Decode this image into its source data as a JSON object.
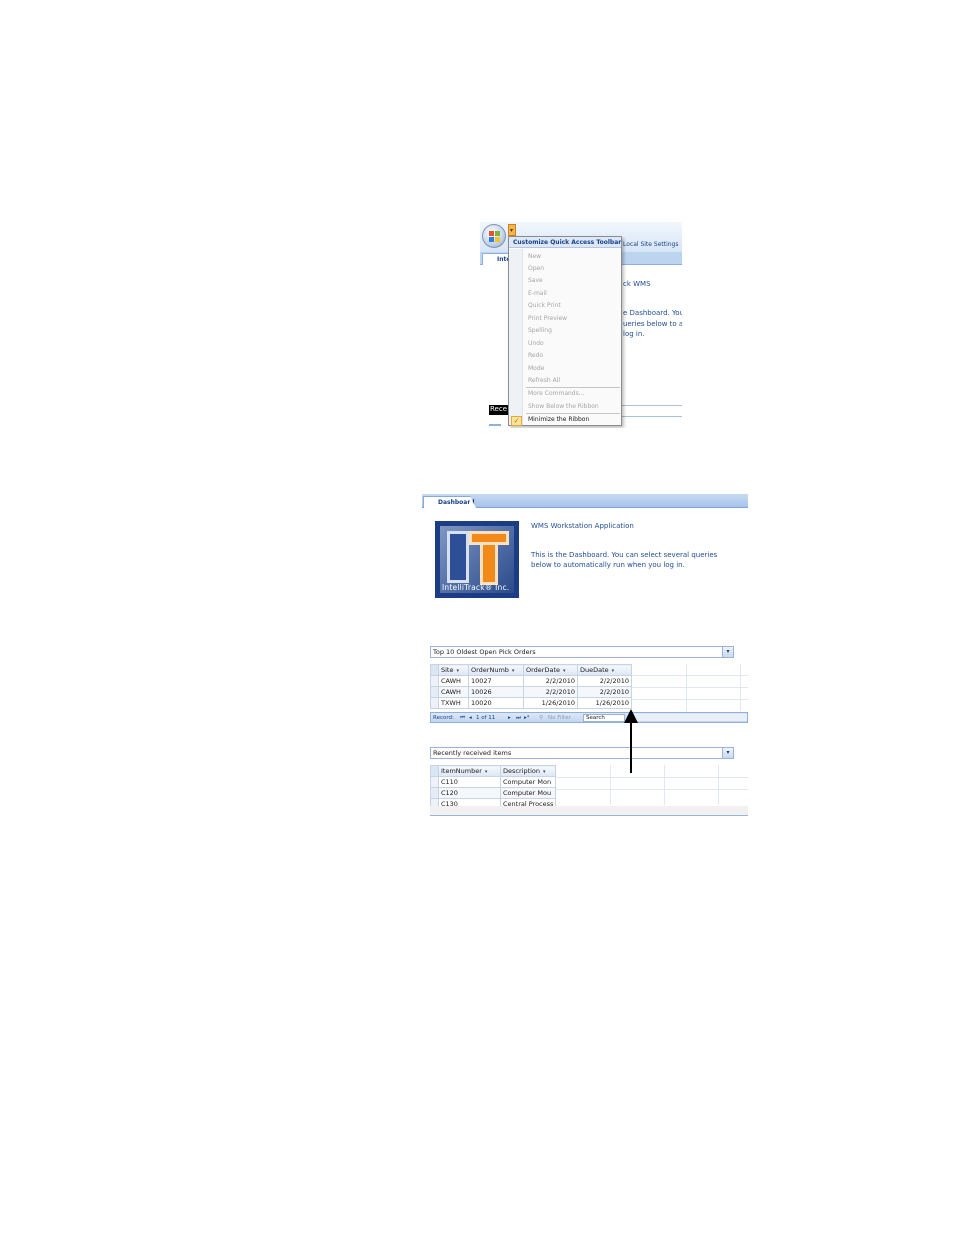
{
  "qat_screenshot": {
    "menu_title": "Customize Quick Access Toolbar",
    "menu_items": [
      "New",
      "Open",
      "Save",
      "E-mail",
      "Quick Print",
      "Print Preview",
      "Spelling",
      "Undo",
      "Redo",
      "Mode",
      "Refresh All"
    ],
    "more_commands": "More Commands...",
    "show_below": "Show Below the Ribbon",
    "minimize": "Minimize the Ribbon",
    "tab_label": "Inte",
    "local_site_settings": "Local Site Settings",
    "bg_text": [
      "ck WMS",
      "e Dashboard.  You",
      "ueries below to a",
      "log in."
    ],
    "rec_label": "Rece"
  },
  "dashboard": {
    "tab_label": "Dashboard",
    "app_title": "WMS Workstation Application",
    "description": "This is the Dashboard. You can select several queries below to automatically run when you log in.",
    "logo_text": "IntelliTrack® Inc.",
    "query1": {
      "label": "Top 10 Oldest Open Pick Orders",
      "columns": [
        "Site",
        "OrderNumb",
        "OrderDate",
        "DueDate"
      ],
      "rows": [
        [
          "CAWH",
          "10027",
          "2/2/2010",
          "2/2/2010"
        ],
        [
          "CAWH",
          "10026",
          "2/2/2010",
          "2/2/2010"
        ],
        [
          "TXWH",
          "10020",
          "1/26/2010",
          "1/26/2010"
        ]
      ]
    },
    "navbar": {
      "record_label": "Record:",
      "record_pos": "1 of 11",
      "no_filter": "No Filter",
      "search": "Search"
    },
    "query2": {
      "label": "Recently received items",
      "columns": [
        "ItemNumber",
        "Description"
      ],
      "rows": [
        [
          "C110",
          "Computer Mon"
        ],
        [
          "C120",
          "Computer Mou"
        ],
        [
          "C130",
          "Central Process"
        ]
      ]
    }
  }
}
